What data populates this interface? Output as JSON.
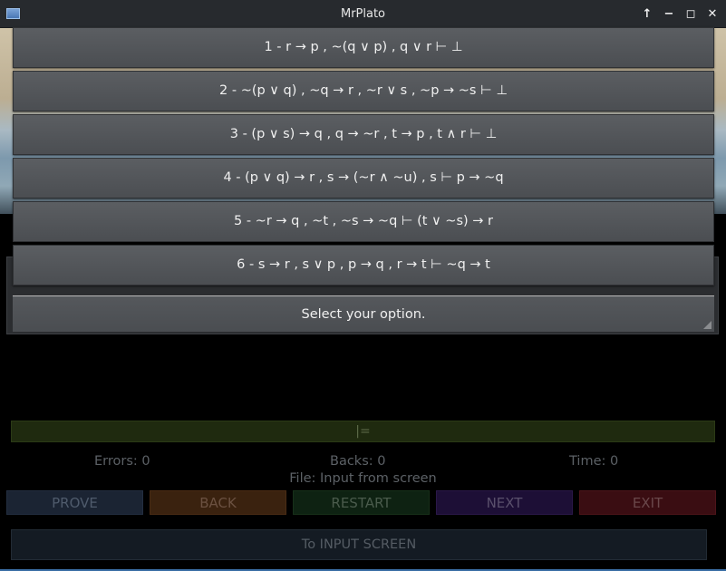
{
  "window": {
    "title": "MrPlato",
    "controls": [
      "keep-above",
      "minimize",
      "maximize",
      "close"
    ]
  },
  "background_text": {
    "line1": "",
    "line2": ""
  },
  "options": [
    {
      "label": "1 - r → p , ~(q ∨ p) , q ∨ r ⊢ ⊥"
    },
    {
      "label": "2 - ~(p ∨ q) , ~q → r , ~r ∨ s , ~p → ~s ⊢ ⊥"
    },
    {
      "label": "3 - (p ∨ s) → q , q → ~r , t → p , t ∧ r ⊢ ⊥"
    },
    {
      "label": "4 - (p ∨ q) → r , s → (~r ∧ ~u) , s ⊢ p → ~q"
    },
    {
      "label": "5 - ~r → q , ~t , ~s → ~q ⊢ (t ∨ ~s) → r"
    },
    {
      "label": "6 - s → r , s ∨ p , p → q , r → t ⊢ ~q → t"
    }
  ],
  "prompt": "Select your option.",
  "formula": "|=",
  "stats": {
    "errors": "Errors: 0",
    "backs": "Backs: 0",
    "time": "Time: 0"
  },
  "file_label": "File: Input from screen",
  "actions": {
    "prove": "PROVE",
    "back": "BACK",
    "restart": "RESTART",
    "next": "NEXT",
    "exit": "EXIT"
  },
  "input_screen_label": "To INPUT SCREEN",
  "colors": {
    "prove": "#1b2433",
    "back": "#3a220f",
    "restart": "#0e2212",
    "next": "#1d0f36",
    "exit": "#3a0d12"
  }
}
